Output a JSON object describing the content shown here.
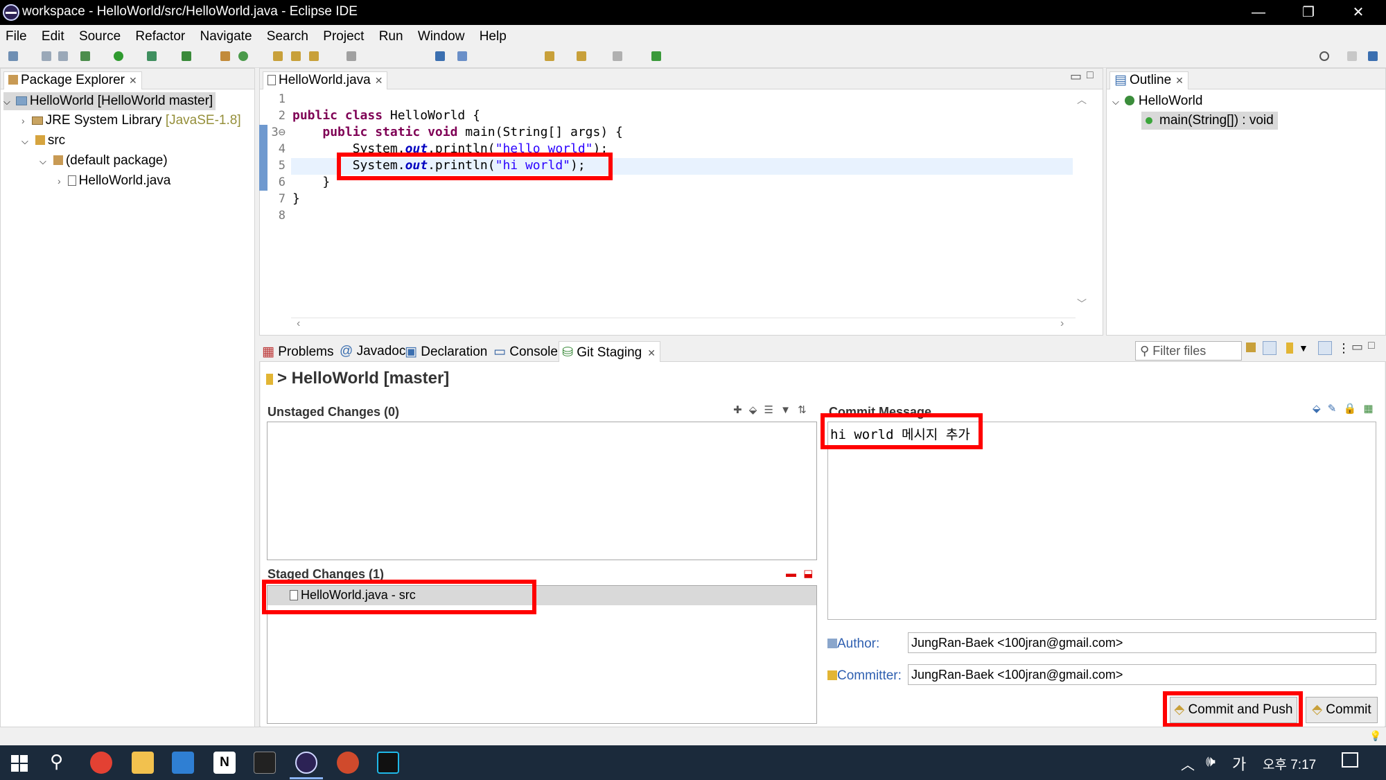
{
  "window": {
    "title": "workspace - HelloWorld/src/HelloWorld.java - Eclipse IDE",
    "minimize": "—",
    "restore": "❐",
    "close": "✕"
  },
  "menu": [
    "File",
    "Edit",
    "Source",
    "Refactor",
    "Navigate",
    "Search",
    "Project",
    "Run",
    "Window",
    "Help"
  ],
  "package_explorer": {
    "tab": "Package Explorer",
    "project": "HelloWorld [HelloWorld master]",
    "jre": "JRE System Library",
    "jre_version": "[JavaSE-1.8]",
    "src": "src",
    "package": "(default package)",
    "file": "HelloWorld.java"
  },
  "editor": {
    "tab": "HelloWorld.java",
    "line_numbers": [
      "1",
      "2",
      "3⊖",
      "4",
      "5",
      "6",
      "7",
      "8"
    ]
  },
  "outline": {
    "tab": "Outline",
    "class": "HelloWorld",
    "method": "main(String[]) : void"
  },
  "bottom_tabs": {
    "problems": "Problems",
    "javadoc": "Javadoc",
    "declaration": "Declaration",
    "console": "Console",
    "git_staging": "Git Staging",
    "filter_placeholder": "Filter files"
  },
  "git_staging": {
    "repo": "> HelloWorld [master]",
    "unstaged_title": "Unstaged Changes (0)",
    "staged_title": "Staged Changes (1)",
    "staged_item": "HelloWorld.java - src",
    "commit_message_title": "Commit Message",
    "commit_message": "hi world 메시지 추가",
    "author_label": "Author:",
    "author": "JungRan-Baek <100jran@gmail.com>",
    "committer_label": "Committer:",
    "committer": "JungRan-Baek <100jran@gmail.com>",
    "commit_and_push": "Commit and Push",
    "commit": "Commit"
  },
  "taskbar": {
    "ime": "가",
    "time": "오후 7:17"
  }
}
